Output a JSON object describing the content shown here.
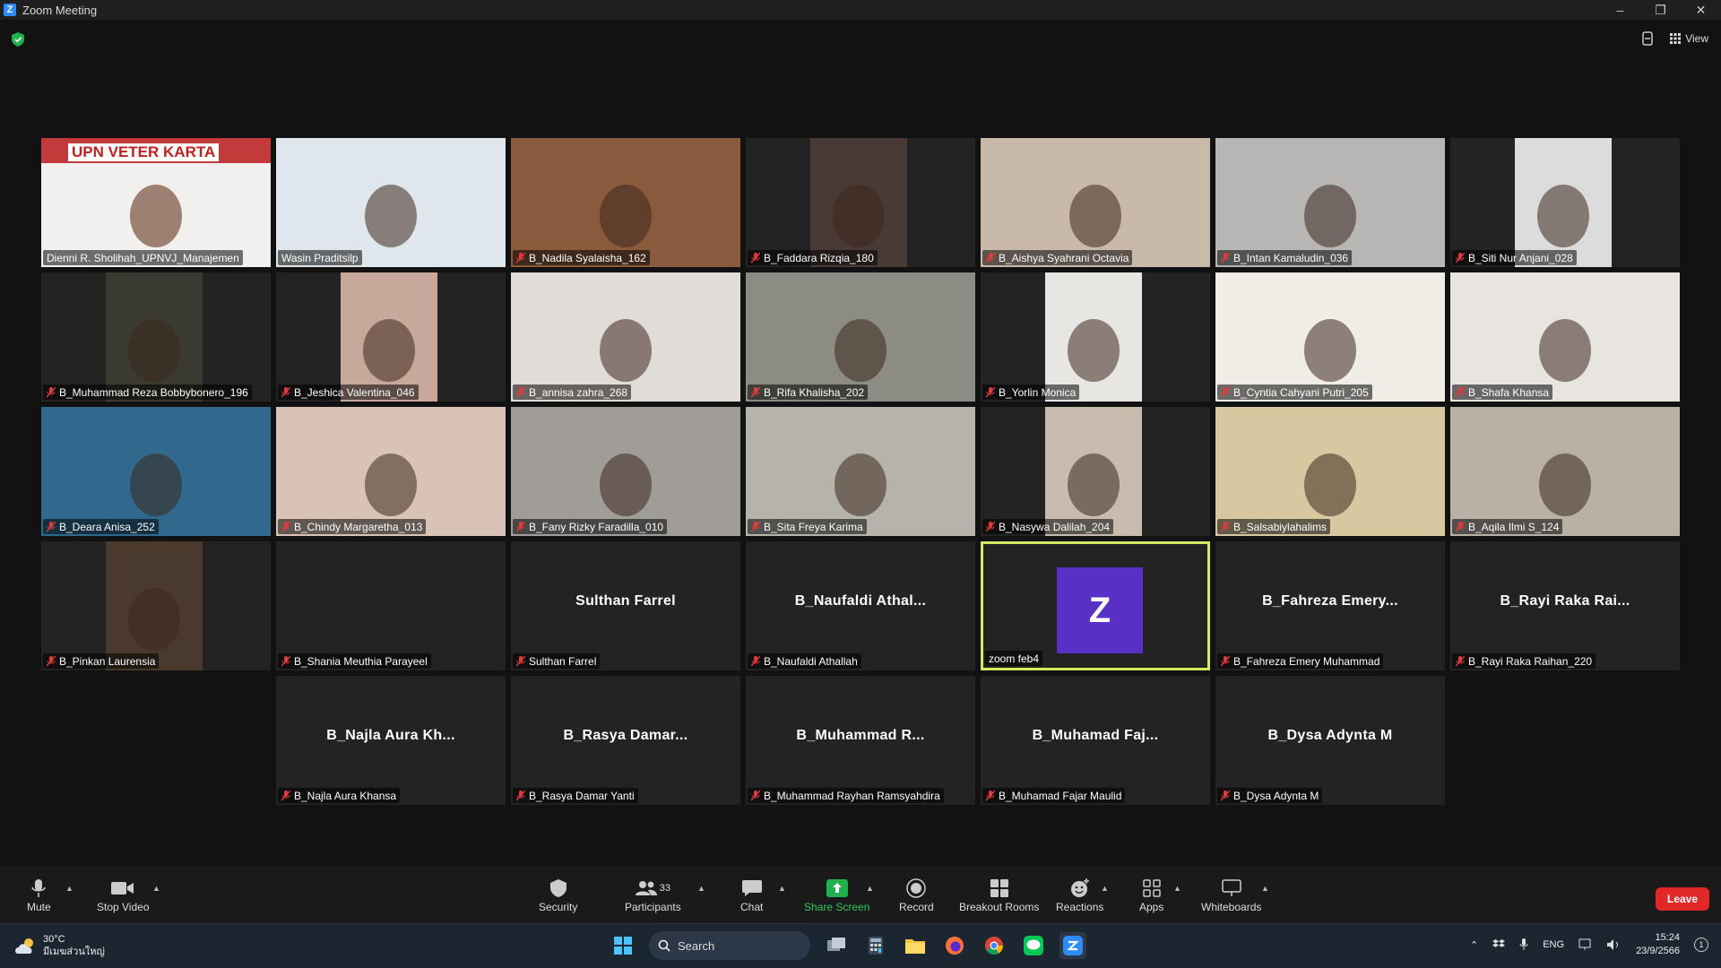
{
  "window": {
    "title": "Zoom Meeting"
  },
  "top": {
    "view_label": "View"
  },
  "tiles": [
    {
      "name": "Dienni R. Sholihah_UPNVJ_Manajemen",
      "muted": false,
      "video": "banner",
      "bg": "#c23a3a",
      "banner_text": "UPN VETER    KARTA"
    },
    {
      "name": "Wasin Praditsilp",
      "muted": false,
      "video": "full",
      "bg": "#dfe7ec"
    },
    {
      "name": "B_Nadila Syalaisha_162",
      "muted": true,
      "video": "full",
      "bg": "#8a5a3c"
    },
    {
      "name": "B_Faddara Rizqia_180",
      "muted": true,
      "video": "center",
      "bg": "#4a3a36"
    },
    {
      "name": "B_Aishya Syahrani Octavia",
      "muted": true,
      "video": "full",
      "bg": "#c9b9a8"
    },
    {
      "name": "B_Intan Kamaludin_036",
      "muted": true,
      "video": "full",
      "bg": "#b7b6b4"
    },
    {
      "name": "B_Siti Nur Anjani_028",
      "muted": true,
      "video": "center",
      "bg": "#dcdcdc"
    },
    {
      "name": "B_Muhammad Reza Bobbybonero_196",
      "muted": true,
      "video": "center",
      "bg": "#3b3a30"
    },
    {
      "name": "B_Jeshica Valentina_046",
      "muted": true,
      "video": "center",
      "bg": "#c8a89a"
    },
    {
      "name": "B_annisa zahra_268",
      "muted": true,
      "video": "full",
      "bg": "#e2dcd8"
    },
    {
      "name": "B_Rifa Khalisha_202",
      "muted": true,
      "video": "full",
      "bg": "#8c8c82"
    },
    {
      "name": "B_Yorlin Monica",
      "muted": true,
      "video": "center",
      "bg": "#e8e6e3"
    },
    {
      "name": "B_Cyntia Cahyani Putri_205",
      "muted": true,
      "video": "full",
      "bg": "#f0ece6"
    },
    {
      "name": "B_Shafa Khansa",
      "muted": true,
      "video": "full",
      "bg": "#e8e4e0"
    },
    {
      "name": "B_Deara Anisa_252",
      "muted": true,
      "video": "full",
      "bg": "#2f6a8e"
    },
    {
      "name": "B_Chindy Margaretha_013",
      "muted": true,
      "video": "full",
      "bg": "#d9c3b6"
    },
    {
      "name": "B_Fany Rizky Faradilla_010",
      "muted": true,
      "video": "full",
      "bg": "#a09c98"
    },
    {
      "name": "B_Sita Freya Karima",
      "muted": true,
      "video": "full",
      "bg": "#b6b3ab"
    },
    {
      "name": "B_Nasywa Dalilah_204",
      "muted": true,
      "video": "center",
      "bg": "#c8bcae"
    },
    {
      "name": "B_Salsabiylahalims",
      "muted": true,
      "video": "full",
      "bg": "#d8c8a0"
    },
    {
      "name": "B_Aqila Ilmi S_124",
      "muted": true,
      "video": "full",
      "bg": "#b9b0a6"
    },
    {
      "name": "B_Pinkan Laurensia",
      "muted": true,
      "video": "center",
      "bg": "#4a3a2e"
    },
    {
      "name": "B_Shania Meuthia Parayeel",
      "muted": true,
      "video": "none"
    },
    {
      "name": "Sulthan Farrel",
      "muted": true,
      "video": "none",
      "bigname": "Sulthan Farrel"
    },
    {
      "name": "B_Naufaldi Athallah",
      "muted": true,
      "video": "none",
      "bigname": "B_Naufaldi  Athal..."
    },
    {
      "name": "zoom feb4",
      "muted": false,
      "video": "avatar",
      "avatar_letter": "Z",
      "active": true
    },
    {
      "name": "B_Fahreza Emery Muhammad",
      "muted": true,
      "video": "none",
      "bigname": "B_Fahreza  Emery..."
    },
    {
      "name": "B_Rayi Raka Raihan_220",
      "muted": true,
      "video": "none",
      "bigname": "B_Rayi  Raka  Rai..."
    },
    {
      "name": "B_Najla Aura Khansa",
      "muted": true,
      "video": "none",
      "bigname": "B_Najla  Aura  Kh..."
    },
    {
      "name": "B_Rasya Damar Yanti",
      "muted": true,
      "video": "none",
      "bigname": "B_Rasya  Damar..."
    },
    {
      "name": "B_Muhammad Rayhan Ramsyahdira",
      "muted": true,
      "video": "none",
      "bigname": "B_Muhammad  R..."
    },
    {
      "name": "B_Muhamad Fajar Maulid",
      "muted": true,
      "video": "none",
      "bigname": "B_Muhamad  Faj..."
    },
    {
      "name": "B_Dysa Adynta M",
      "muted": true,
      "video": "none",
      "bigname": "B_Dysa  Adynta  M"
    }
  ],
  "toolbar": {
    "mute": "Mute",
    "stop_video": "Stop Video",
    "security": "Security",
    "participants": "Participants",
    "participants_count": "33",
    "chat": "Chat",
    "share_screen": "Share Screen",
    "record": "Record",
    "breakout": "Breakout Rooms",
    "reactions": "Reactions",
    "apps": "Apps",
    "whiteboards": "Whiteboards",
    "leave": "Leave"
  },
  "taskbar": {
    "temperature": "30°C",
    "weather_text": "มีเมฆส่วนใหญ่",
    "search": "Search",
    "lang": "ENG",
    "time": "15:24",
    "date": "23/9/2566",
    "notif_count": "1"
  },
  "colors": {
    "accent_green": "#34c759",
    "leave_red": "#e02828",
    "active_border": "#d7ea5e",
    "avatar_purple": "#5a2fc5"
  }
}
